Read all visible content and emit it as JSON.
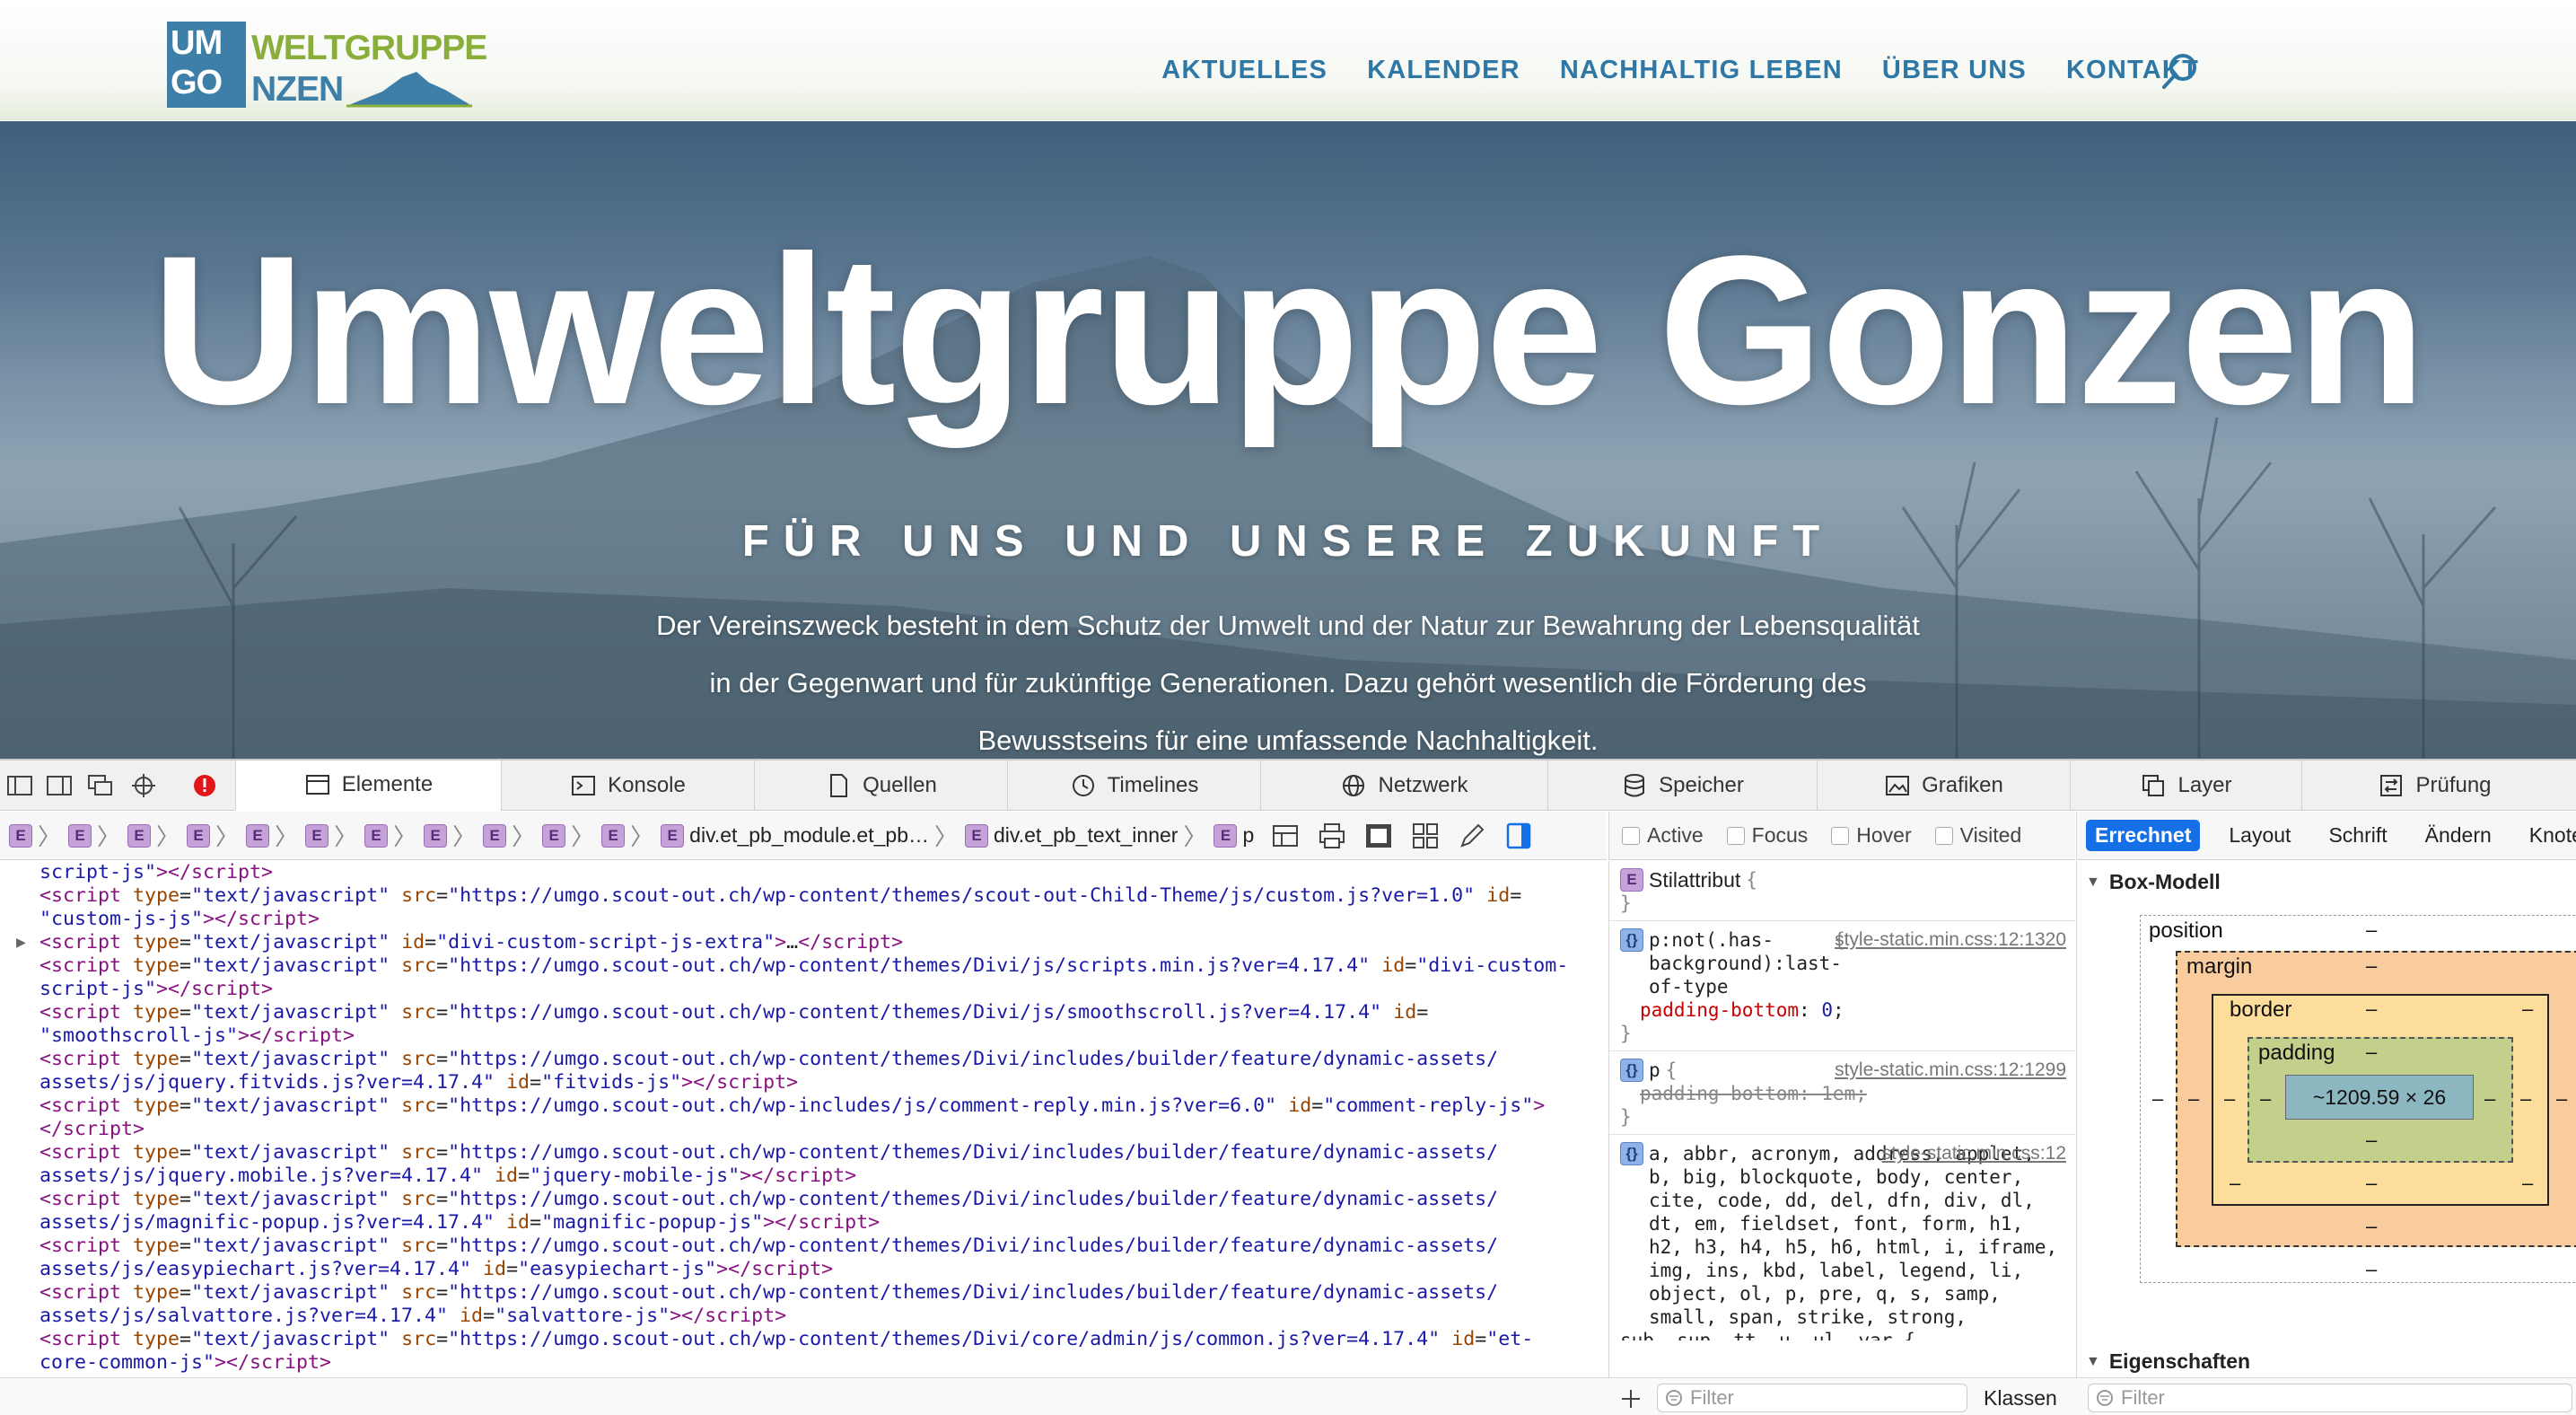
{
  "site": {
    "logo": {
      "box_top": "UM",
      "box_bottom": "GO",
      "line1": "WELTGRUPPE",
      "line2": "NZEN"
    },
    "nav": [
      "AKTUELLES",
      "KALENDER",
      "NACHHALTIG LEBEN",
      "ÜBER UNS",
      "KONTAKT"
    ],
    "search_icon": "search-icon",
    "hero": {
      "title": "Umweltgruppe Gonzen",
      "subtitle": "FÜR UNS UND UNSERE ZUKUNFT",
      "text": "Der Vereinszweck besteht in dem Schutz der Umwelt und der Natur zur Bewahrung der Lebensqualität in der Gegenwart und für zukünftige Generationen. Dazu gehört wesentlich die Förderung des Bewusstseins für eine umfassende Nachhaltigkeit."
    },
    "colors": {
      "brand_blue": "#3e7fa8",
      "brand_green": "#8aae3c",
      "nav_blue": "#2f78a6"
    }
  },
  "devtools": {
    "tabs": [
      "Elemente",
      "Konsole",
      "Quellen",
      "Timelines",
      "Netzwerk",
      "Speicher",
      "Grafiken",
      "Layer",
      "Prüfung"
    ],
    "active_tab": "Elemente",
    "breadcrumb": {
      "e_label": "E",
      "module": "div.et_pb_module.et_pb…",
      "inner": "div.et_pb_text_inner",
      "last": "p"
    },
    "pseudo": [
      "Active",
      "Focus",
      "Hover",
      "Visited"
    ],
    "side_tabs": [
      "Errechnet",
      "Layout",
      "Schrift",
      "Ändern",
      "Knoten"
    ],
    "styles": {
      "style_attr": "Stilattribut",
      "rule1_selector": "p:not(.has-background):last-of-type",
      "rule1_source": "style-static.min.css:12:1320",
      "rule1_prop": "padding-bottom",
      "rule1_value": "0",
      "rule2_selector": "p",
      "rule2_source": "style-static.min.css:12:1299",
      "rule2_decl": "padding-bottom: 1em;",
      "rule3_source": "style-static.min.css:12",
      "rule3_selector": "a, abbr, acronym, address, applet, b, big, blockquote, body, center, cite, code, dd, del, dfn, div, dl, dt, em, fieldset, font, form, h1, h2, h3, h4, h5, h6, html, i, iframe, img, ins, kbd, label, legend, li, object, ol, p, pre, q, s, samp, small, span, strike, strong,",
      "rule3_more": "sub, sup, tt, u, ul, var {"
    },
    "box_model": {
      "title": "Box-Modell",
      "position": "position",
      "margin": "margin",
      "border": "border",
      "padding": "padding",
      "content": "~1209.59 × 26",
      "dash": "–",
      "next_section": "Eigenschaften"
    },
    "filter_placeholder": "Filter",
    "classes_button": "Klassen"
  }
}
